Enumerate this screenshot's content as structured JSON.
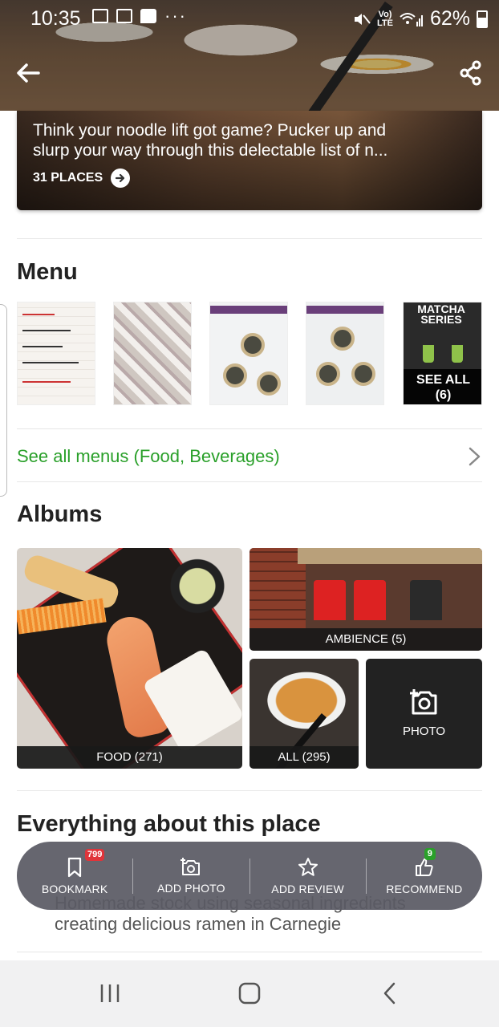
{
  "status_bar": {
    "time": "10:35",
    "battery": "62%",
    "more_dots": "···",
    "volte_top": "Vo)",
    "volte_bottom": "LTE"
  },
  "collection": {
    "description_line1": "Think your noodle lift got game? Pucker up and",
    "description_line2": "slurp your way through this delectable list of n...",
    "count": "31 PLACES"
  },
  "menu": {
    "title": "Menu",
    "see_all_label": "SEE ALL",
    "see_all_count": "(6)",
    "thumb5_heading": "MATCHA SERIES",
    "see_all_menus": "See all menus (Food, Beverages)"
  },
  "albums": {
    "title": "Albums",
    "items": [
      {
        "label": "FOOD (271)"
      },
      {
        "label": "AMBIENCE (5)"
      },
      {
        "label": "ALL (295)"
      }
    ],
    "add_photo_label": "PHOTO"
  },
  "everything": {
    "title": "Everything about this place",
    "text_line1": "Homemade stock using seasonal ingredients",
    "text_line2": "creating delicious ramen in Carnegie"
  },
  "action_bar": {
    "bookmark": {
      "label": "BOOKMARK",
      "badge": "799"
    },
    "add_photo": {
      "label": "ADD PHOTO"
    },
    "add_review": {
      "label": "ADD REVIEW"
    },
    "recommend": {
      "label": "RECOMMEND",
      "badge": "9"
    }
  },
  "colors": {
    "accent_green": "#2aa02a",
    "badge_red": "#e0343a",
    "action_bar_bg": "#5a5a64"
  }
}
